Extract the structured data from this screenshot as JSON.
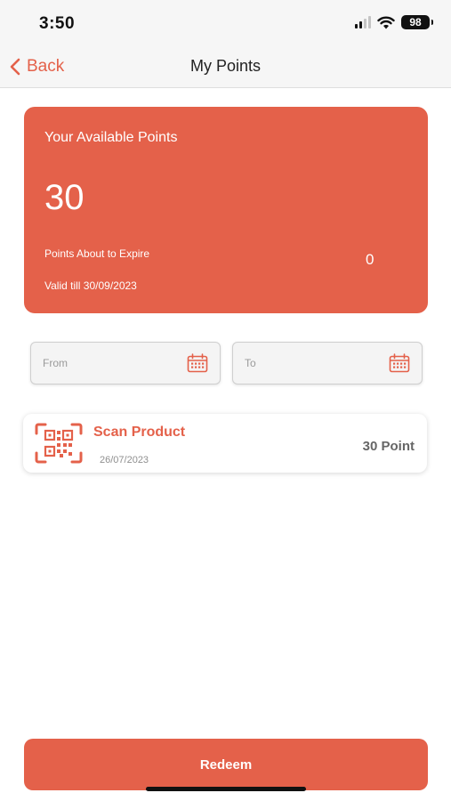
{
  "status_bar": {
    "time": "3:50",
    "battery": "98",
    "icons": [
      "signal-icon",
      "wifi-icon",
      "battery-icon"
    ]
  },
  "nav": {
    "back_label": "Back",
    "title": "My Points",
    "back_icon": "chevron-left-icon"
  },
  "points_card": {
    "title": "Your Available Points",
    "value": "30",
    "expire_label": "Points About to Expire",
    "expire_value": "0",
    "valid_till": "Valid till 30/09/2023"
  },
  "filters": {
    "from_placeholder": "From",
    "to_placeholder": "To",
    "icon": "calendar-icon"
  },
  "transactions": [
    {
      "icon": "qr-code-icon",
      "title": "Scan Product",
      "date": "26/07/2023",
      "points": "30 Point"
    }
  ],
  "redeem_label": "Redeem",
  "colors": {
    "accent": "#e4614a",
    "header_bg": "#f6f6f6"
  }
}
